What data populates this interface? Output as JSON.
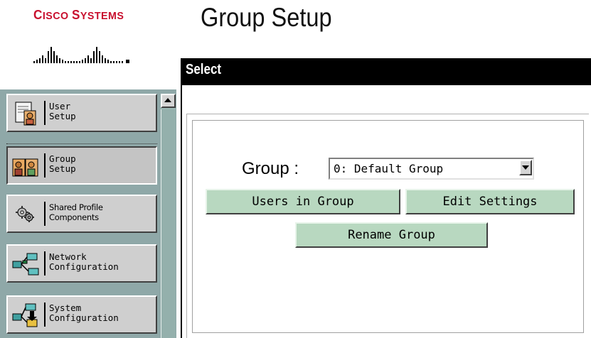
{
  "logo": {
    "brand_text_lead_c": "C",
    "brand_text_rest_1": "ISCO ",
    "brand_text_lead_s": "S",
    "brand_text_rest_2": "YSTEMS"
  },
  "page": {
    "title": "Group Setup"
  },
  "select_bar": {
    "label": "Select"
  },
  "sidebar": {
    "items": [
      {
        "label": "User\nSetup",
        "icon": "user-setup-icon",
        "active": false
      },
      {
        "label": "Group\nSetup",
        "icon": "group-setup-icon",
        "active": true
      },
      {
        "label": "Shared Profile\nComponents",
        "icon": "shared-profile-icon",
        "active": false
      },
      {
        "label": "Network\nConfiguration",
        "icon": "network-config-icon",
        "active": false
      },
      {
        "label": "System\nConfiguration",
        "icon": "system-config-icon",
        "active": false
      }
    ]
  },
  "group_form": {
    "label": "Group :",
    "selected_group": "0: Default Group",
    "buttons": {
      "users_in_group": "Users in Group",
      "edit_settings": "Edit Settings",
      "rename_group": "Rename Group"
    }
  },
  "colors": {
    "brand_red": "#c8102e",
    "sidebar_bg": "#8fa8a8",
    "button_green": "#b8d8c0",
    "header_black": "#000000"
  }
}
